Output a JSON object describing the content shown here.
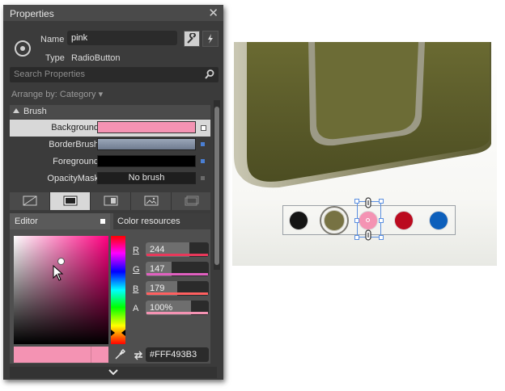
{
  "panel": {
    "title": "Properties",
    "name_label": "Name",
    "name_value": "pink",
    "type_label": "Type",
    "type_value": "RadioButton",
    "search_placeholder": "Search Properties",
    "arrange": "Arrange by: Category ▾"
  },
  "brush": {
    "header": "Brush",
    "rows": [
      {
        "name": "Background",
        "color": "#F493B3",
        "text": ""
      },
      {
        "name": "BorderBrush",
        "color": "#8D9BB0",
        "text": ""
      },
      {
        "name": "Foreground",
        "color": "#000000",
        "text": ""
      },
      {
        "name": "OpacityMask",
        "color": "#1E1E1E",
        "text": "No brush"
      }
    ]
  },
  "editor": {
    "tab_editor": "Editor",
    "tab_resources": "Color resources",
    "channels": [
      {
        "label": "R",
        "value": "244",
        "level": 0.957,
        "bar_color": "#e8385a"
      },
      {
        "label": "G",
        "value": "147",
        "level": 0.576,
        "bar_color": "#e060c0"
      },
      {
        "label": "B",
        "value": "179",
        "level": 0.702,
        "bar_color": "#ff6060"
      },
      {
        "label": "A",
        "value": "100%",
        "level": 1.0,
        "bar_color": "#f493b3"
      }
    ],
    "hex": "#FFF493B3",
    "current_color": "#F493B3"
  },
  "canvas": {
    "radio_colors": [
      "#141414",
      "#777243",
      "#F493B3",
      "#BB0B1F",
      "#0D5FBB"
    ],
    "selected": "pink"
  }
}
